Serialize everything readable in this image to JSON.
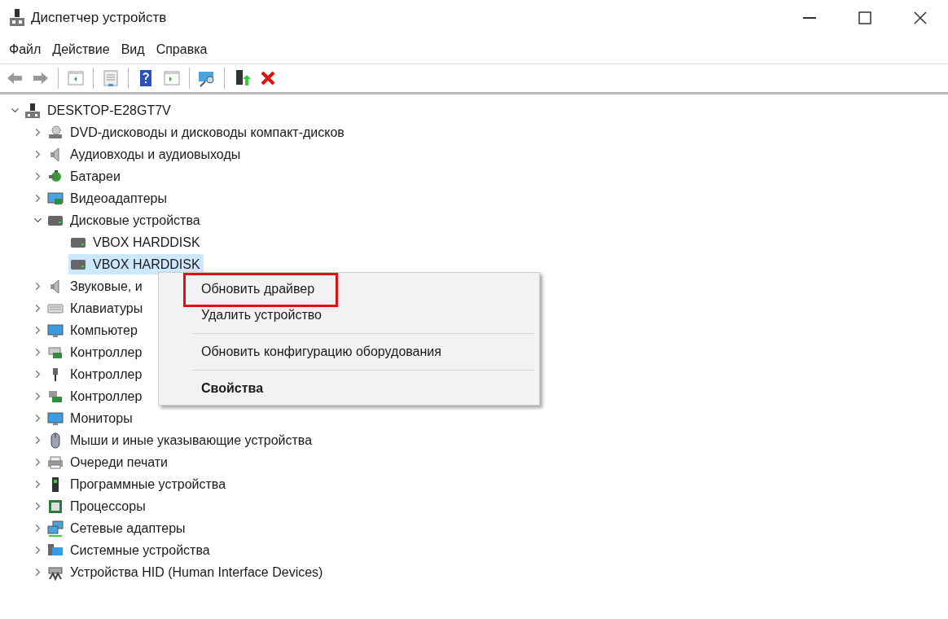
{
  "window": {
    "title": "Диспетчер устройств"
  },
  "menu_bar": [
    "Файл",
    "Действие",
    "Вид",
    "Справка"
  ],
  "tree": {
    "label": "DESKTOP-E28GT7V",
    "expanded": true,
    "selected": false,
    "children": [
      {
        "label": "DVD-дисководы и дисководы компакт-дисков",
        "expanded": false,
        "selected": false
      },
      {
        "label": "Аудиовходы и аудиовыходы",
        "expanded": false,
        "selected": false
      },
      {
        "label": "Батареи",
        "expanded": false,
        "selected": false
      },
      {
        "label": "Видеоадаптеры",
        "expanded": false,
        "selected": false
      },
      {
        "label": "Дисковые устройства",
        "expanded": true,
        "selected": false,
        "children": [
          {
            "label": "VBOX HARDDISK",
            "selected": false
          },
          {
            "label": "VBOX HARDDISK",
            "selected": true
          }
        ]
      },
      {
        "label": "Звуковые, и",
        "expanded": false,
        "selected": false
      },
      {
        "label": "Клавиатуры",
        "expanded": false,
        "selected": false
      },
      {
        "label": "Компьютер",
        "expanded": false,
        "selected": false
      },
      {
        "label": "Контроллер",
        "expanded": false,
        "selected": false
      },
      {
        "label": "Контроллер",
        "expanded": false,
        "selected": false
      },
      {
        "label": "Контроллер",
        "expanded": false,
        "selected": false
      },
      {
        "label": "Мониторы",
        "expanded": false,
        "selected": false
      },
      {
        "label": "Мыши и иные указывающие устройства",
        "expanded": false,
        "selected": false
      },
      {
        "label": "Очереди печати",
        "expanded": false,
        "selected": false
      },
      {
        "label": "Программные устройства",
        "expanded": false,
        "selected": false
      },
      {
        "label": "Процессоры",
        "expanded": false,
        "selected": false
      },
      {
        "label": "Сетевые адаптеры",
        "expanded": false,
        "selected": false
      },
      {
        "label": "Системные устройства",
        "expanded": false,
        "selected": false
      },
      {
        "label": "Устройства HID (Human Interface Devices)",
        "expanded": false,
        "selected": false
      }
    ]
  },
  "context_menu": [
    {
      "kind": "item",
      "label": "Обновить драйвер",
      "default": false,
      "highlighted": true
    },
    {
      "kind": "item",
      "label": "Удалить устройство",
      "default": false,
      "highlighted": false
    },
    {
      "kind": "separator"
    },
    {
      "kind": "item",
      "label": "Обновить конфигурацию оборудования",
      "default": false,
      "highlighted": false
    },
    {
      "kind": "separator"
    },
    {
      "kind": "item",
      "label": "Свойства",
      "default": true,
      "highlighted": false
    }
  ]
}
